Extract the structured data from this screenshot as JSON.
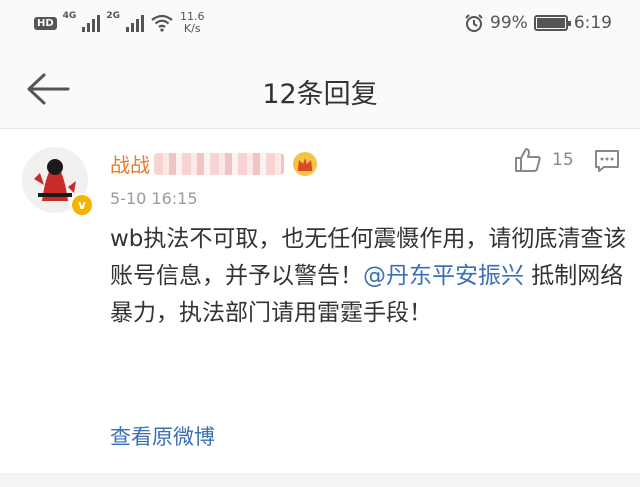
{
  "status": {
    "hd": "HD",
    "sim1_net": "4G",
    "sim2_net": "2G",
    "speed_value": "11.6",
    "speed_unit": "K/s",
    "battery": "99%",
    "battery_level": 0.99,
    "time": "6:19"
  },
  "header": {
    "title": "12条回复"
  },
  "comment": {
    "username": "战战",
    "time": "5-10 16:15",
    "likes": "15",
    "text_before": "wb执法不可取，也无任何震慑作用，请彻底清查该账号信息，并予以警告！",
    "mention": "@丹东平安振兴",
    "text_after": " 抵制网络暴力，执法部门请用雷霆手段！",
    "view_original": "查看原微博"
  },
  "icons": {
    "back": "back-arrow-icon",
    "like": "thumbs-up-icon",
    "comment": "comment-icon",
    "alarm": "alarm-icon",
    "wifi": "wifi-icon"
  },
  "colors": {
    "username": "#e97b30",
    "link": "#3b6fb6",
    "badge": "#f4b400"
  }
}
